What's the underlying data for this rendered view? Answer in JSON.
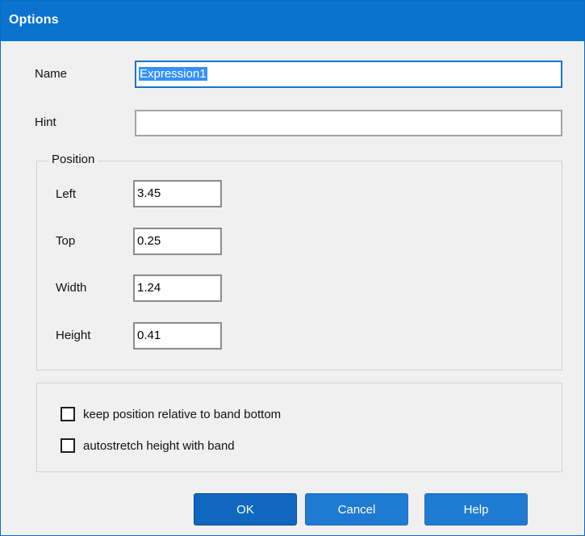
{
  "window": {
    "title": "Options"
  },
  "fields": {
    "name_label": "Name",
    "name_value": "Expression1",
    "hint_label": "Hint",
    "hint_value": ""
  },
  "position": {
    "group_title": "Position",
    "left_label": "Left",
    "left_value": "3.45",
    "top_label": "Top",
    "top_value": "0.25",
    "width_label": "Width",
    "width_value": "1.24",
    "height_label": "Height",
    "height_value": "0.41"
  },
  "options": {
    "keep_position_label": "keep position relative to band bottom",
    "keep_position_checked": false,
    "autostretch_label": "autostretch height with band",
    "autostretch_checked": false
  },
  "buttons": {
    "ok_label": "OK",
    "cancel_label": "Cancel",
    "help_label": "Help"
  },
  "colors": {
    "titlebar": "#0a73d0",
    "button": "#1f7ad2",
    "default_button": "#0f67be",
    "focus_border": "#1a73c9"
  }
}
